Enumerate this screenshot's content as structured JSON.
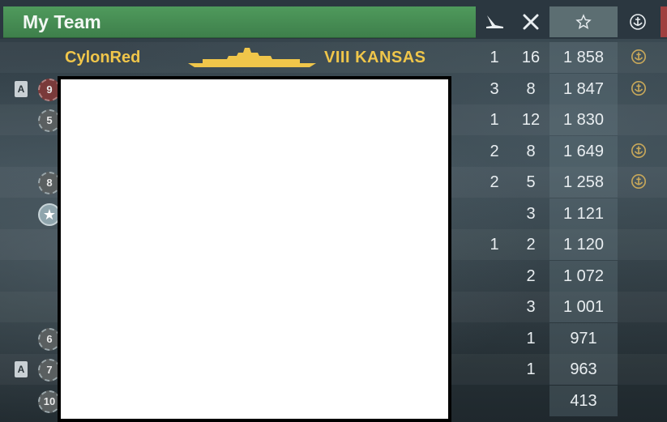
{
  "header": {
    "team_title": "My Team",
    "columns": [
      "planes-destroyed-icon",
      "ships-destroyed-icon",
      "star-icon",
      "anchor-emblem-icon"
    ]
  },
  "players": [
    {
      "name": "CylonRed",
      "ship": "VIII  KANSAS",
      "badge": "",
      "rank": "",
      "planes": "1",
      "kills": "16",
      "xp": "1 858",
      "anchor": true
    },
    {
      "name": "",
      "ship": "",
      "badge": "A",
      "rank": "9",
      "planes": "3",
      "kills": "8",
      "xp": "1 847",
      "anchor": true
    },
    {
      "name": "",
      "ship": "",
      "badge": "",
      "rank": "5",
      "planes": "1",
      "kills": "12",
      "xp": "1 830",
      "anchor": false
    },
    {
      "name": "",
      "ship": "",
      "badge": "",
      "rank": "",
      "planes": "2",
      "kills": "8",
      "xp": "1 649",
      "anchor": true
    },
    {
      "name": "",
      "ship": "",
      "badge": "",
      "rank": "8",
      "planes": "2",
      "kills": "5",
      "xp": "1 258",
      "anchor": true
    },
    {
      "name": "",
      "ship": "",
      "badge": "",
      "rank": "★",
      "planes": "",
      "kills": "3",
      "xp": "1 121",
      "anchor": false
    },
    {
      "name": "",
      "ship": "",
      "badge": "",
      "rank": "",
      "planes": "1",
      "kills": "2",
      "xp": "1 120",
      "anchor": false
    },
    {
      "name": "",
      "ship": "",
      "badge": "",
      "rank": "",
      "planes": "",
      "kills": "2",
      "xp": "1 072",
      "anchor": false
    },
    {
      "name": "",
      "ship": "",
      "badge": "",
      "rank": "",
      "planes": "",
      "kills": "3",
      "xp": "1 001",
      "anchor": false
    },
    {
      "name": "",
      "ship": "",
      "badge": "",
      "rank": "6",
      "planes": "",
      "kills": "1",
      "xp": "971",
      "anchor": false
    },
    {
      "name": "",
      "ship": "",
      "badge": "A",
      "rank": "7",
      "planes": "",
      "kills": "1",
      "xp": "963",
      "anchor": false
    },
    {
      "name": "",
      "ship": "",
      "badge": "",
      "rank": "10",
      "planes": "",
      "kills": "",
      "xp": "413",
      "anchor": false
    }
  ],
  "colors": {
    "team_header": "#4f9a5c",
    "player_highlight": "#f0c64a",
    "anchor": "#c8a85a"
  }
}
